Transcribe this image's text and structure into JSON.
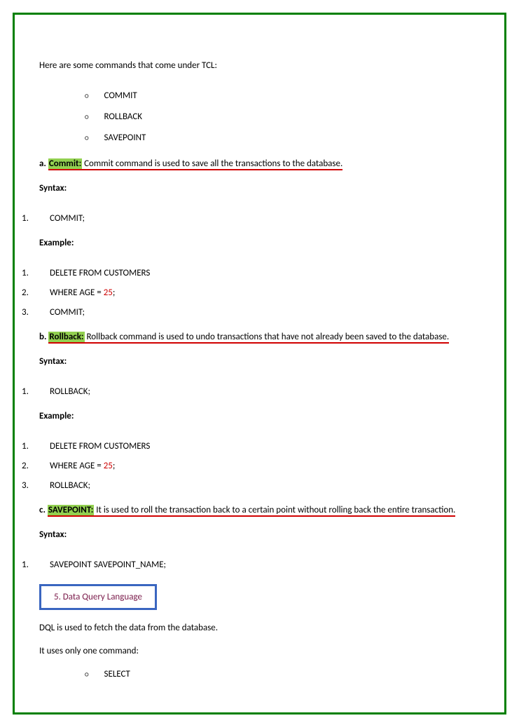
{
  "intro": "Here are some commands that come under TCL:",
  "tcl_commands": {
    "0": "COMMIT",
    "1": "ROLLBACK",
    "2": "SAVEPOINT"
  },
  "commit": {
    "prefix": "a. ",
    "title": "Commit:",
    "desc": " Commit command is used to save all the transactions to the database.",
    "syntax_label": "Syntax:",
    "syntax_line": "COMMIT;",
    "example_label": "Example:",
    "ex": {
      "0": "DELETE FROM CUSTOMERS",
      "1_a": "WHERE AGE = ",
      "1_b": "25",
      "1_c": ";",
      "2": "COMMIT;"
    }
  },
  "rollback": {
    "prefix": "b. ",
    "title": "Rollback:",
    "desc": " Rollback command is used to undo transactions that have not already been saved to the database.",
    "syntax_label": "Syntax:",
    "syntax_line": "ROLLBACK;",
    "example_label": "Example:",
    "ex": {
      "0": "DELETE FROM CUSTOMERS",
      "1_a": "WHERE AGE = ",
      "1_b": "25",
      "1_c": ";",
      "2": "ROLLBACK;"
    }
  },
  "savepoint": {
    "prefix": "c. ",
    "title": "SAVEPOINT:",
    "desc": " It is used to roll the transaction back to a certain point without rolling back the entire transaction.",
    "syntax_label": "Syntax:",
    "syntax_line": " SAVEPOINT SAVEPOINT_NAME;"
  },
  "dql": {
    "heading": "5. Data Query Language",
    "line1": "DQL is used to fetch the data from the database.",
    "line2": "It uses only one command:",
    "cmd": "SELECT"
  }
}
